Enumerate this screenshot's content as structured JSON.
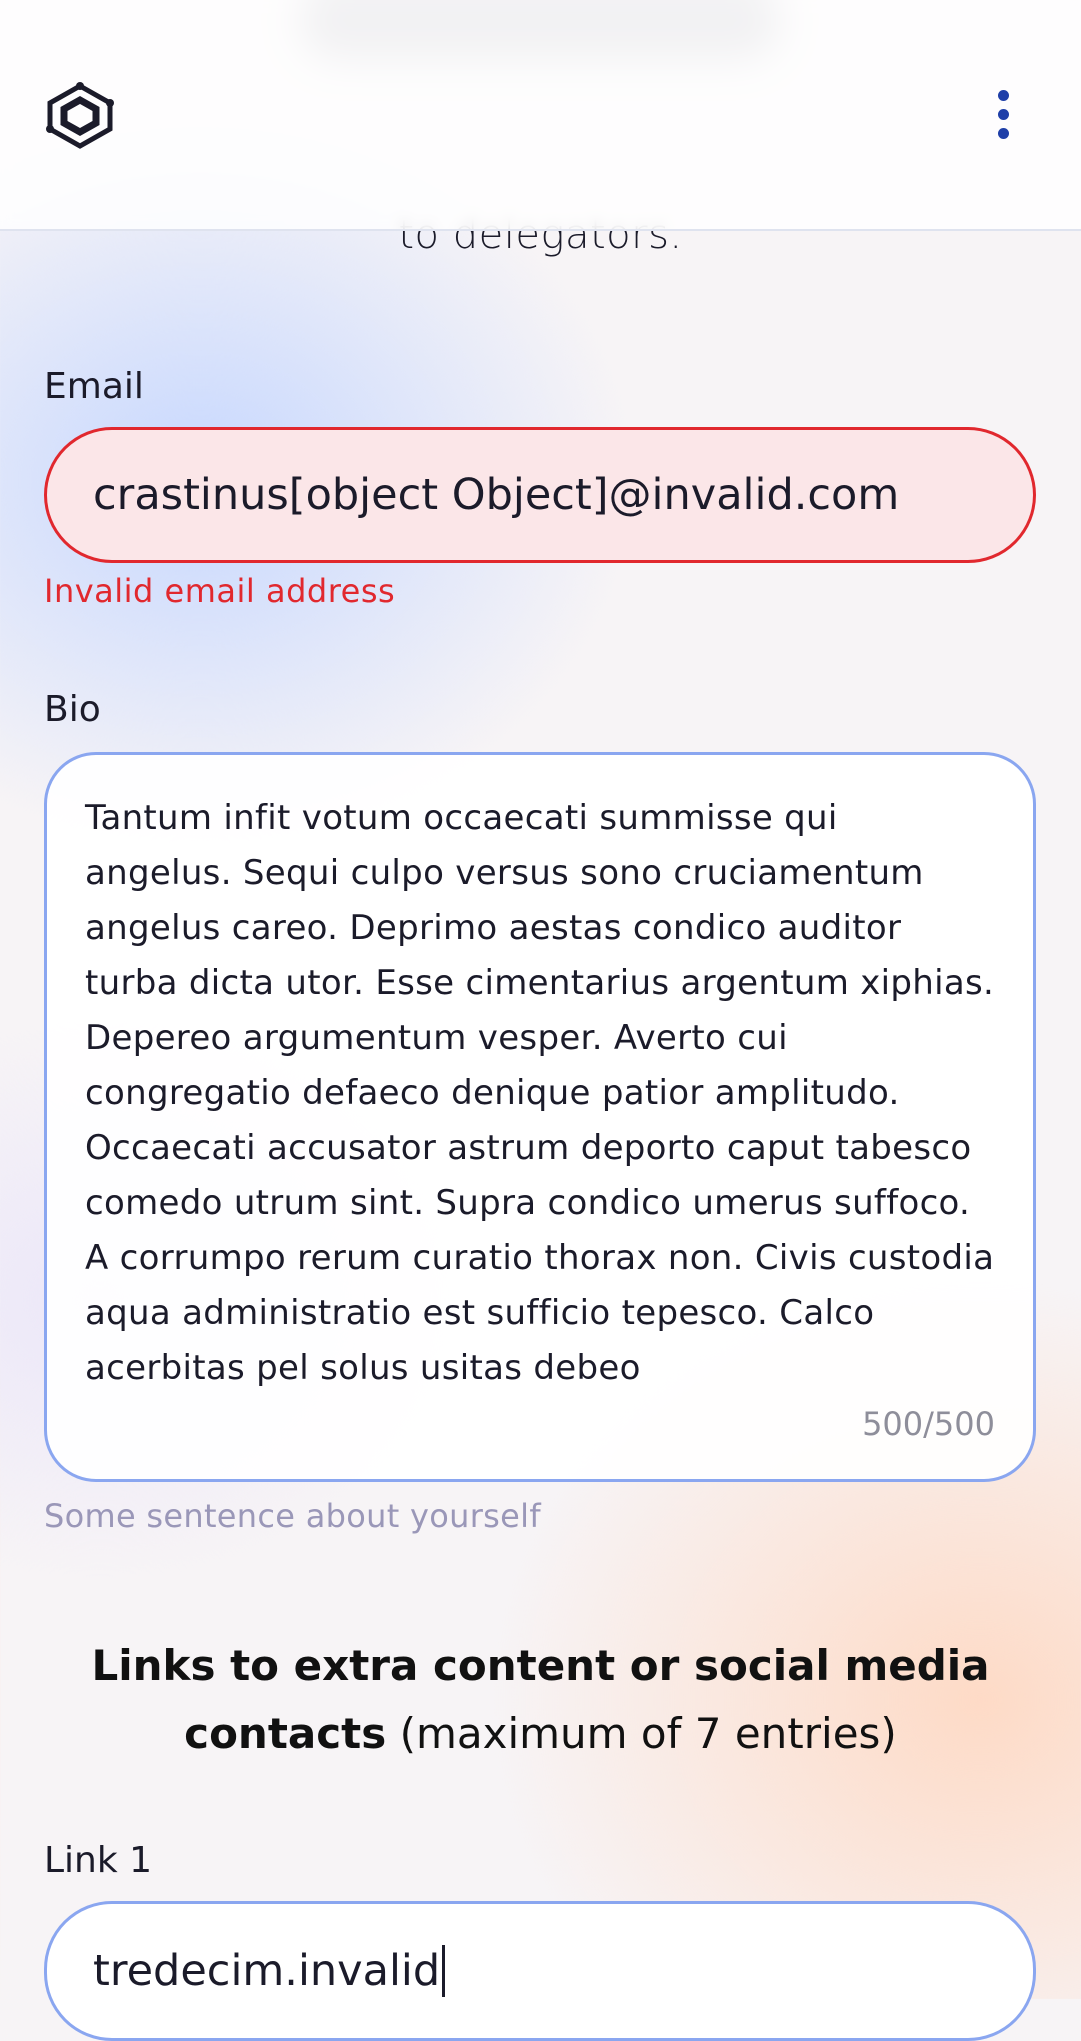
{
  "header": {
    "subtitle_fragment": "to delegators."
  },
  "form": {
    "email": {
      "label": "Email",
      "value": "crastinus[object Object]@invalid.com",
      "error": "Invalid email address"
    },
    "bio": {
      "label": "Bio",
      "value": "Tantum infit votum occaecati summisse qui angelus. Sequi culpo versus sono cruciamentum angelus careo. Deprimo aestas condico auditor turba dicta utor. Esse cimentarius argentum xiphias. Depereo argumentum vesper. Averto cui congregatio defaeco denique patior amplitudo. Occaecati accusator astrum deporto caput tabesco comedo utrum sint. Supra condico umerus suffoco. A corrumpo rerum curatio thorax non. Civis custodia aqua administratio est sufficio tepesco. Calco acerbitas pel solus usitas debeo",
      "counter": "500/500",
      "hint": "Some sentence about yourself"
    },
    "links": {
      "heading_bold": "Links to extra content or social media contacts",
      "heading_note": "(maximum of 7 entries)",
      "items": [
        {
          "label": "Link 1",
          "value": "tredecim.invalid"
        }
      ]
    }
  },
  "colors": {
    "accent": "#1f3fa8",
    "error": "#e1282e",
    "field_border": "#8aa6f0"
  }
}
